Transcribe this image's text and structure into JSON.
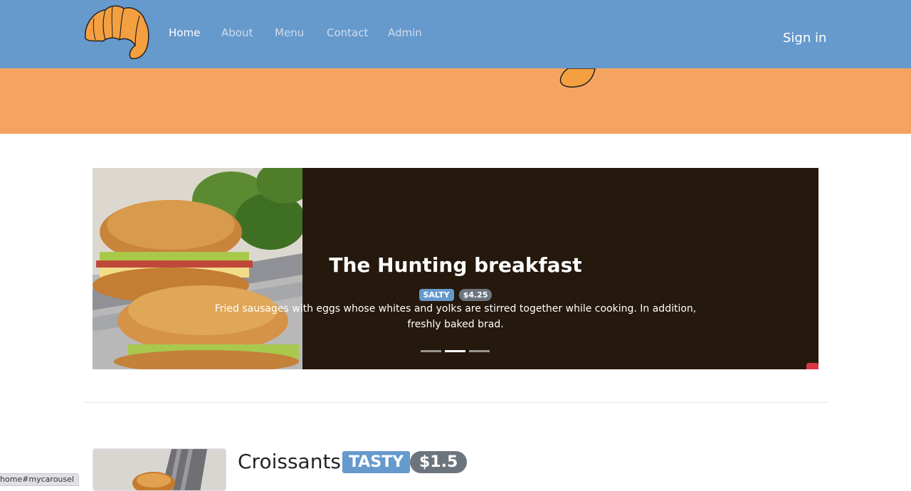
{
  "nav": {
    "links": [
      "Home",
      "About",
      "Menu",
      "Contact",
      "Admin"
    ],
    "signin": "Sign in"
  },
  "carousel": {
    "title": "The Hunting breakfast",
    "tag": "SALTY",
    "price": "$4.25",
    "description": "Fried sausages with eggs whose whites and yolks are stirred together while cooking. In addition, freshly baked brad.",
    "slide_count": 3,
    "active_slide": 2
  },
  "product": {
    "title": "Croissants",
    "tag": "TASTY",
    "price": "$1.5"
  },
  "status_bar": {
    "url": "home#mycarousel"
  },
  "colors": {
    "navbar": "#6699cc",
    "hero": "#f4a460",
    "carousel_bg": "#25180c",
    "badge_primary": "#6699cc",
    "badge_secondary": "#6c757d"
  },
  "icons": {
    "logo": "croissant-logo-icon",
    "mascot": "croissant-mascot-icon"
  }
}
